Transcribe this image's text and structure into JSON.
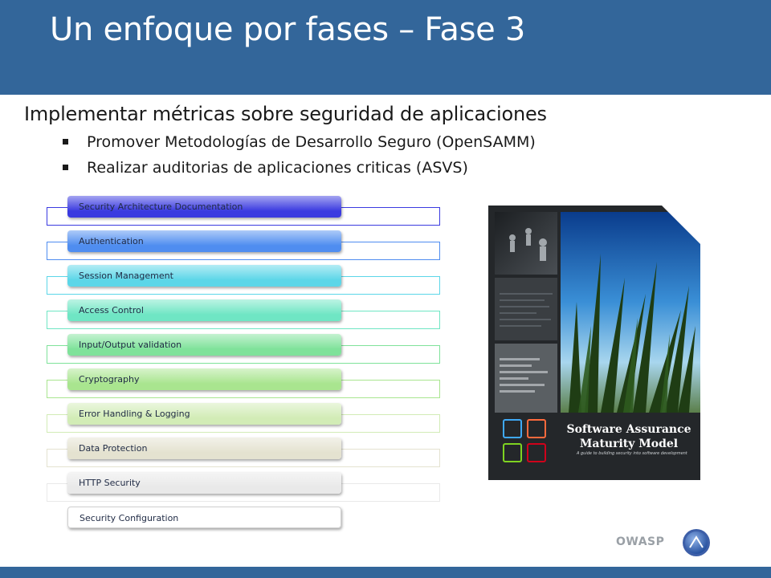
{
  "slide": {
    "title": "Un enfoque por fases – Fase 3",
    "subtitle": "Implementar métricas sobre seguridad de aplicaciones",
    "bullets": [
      "Promover Metodologías de Desarrollo Seguro (OpenSAMM)",
      "Realizar auditorias de aplicaciones criticas (ASVS)"
    ]
  },
  "verification_list": {
    "items": [
      {
        "label": "Security Architecture Documentation",
        "color": "#3a3ae0"
      },
      {
        "label": "Authentication",
        "color": "#4f8df0"
      },
      {
        "label": "Session Management",
        "color": "#5cd6e8"
      },
      {
        "label": "Access Control",
        "color": "#6fe6c4"
      },
      {
        "label": "Input/Output validation",
        "color": "#7fe29a"
      },
      {
        "label": "Cryptography",
        "color": "#a9e58f"
      },
      {
        "label": "Error Handling & Logging",
        "color": "#d2ecb6"
      },
      {
        "label": "Data Protection",
        "color": "#e4e2d0"
      },
      {
        "label": "HTTP Security",
        "color": "#e9e9e9"
      },
      {
        "label": "Security Configuration",
        "color": "#ffffff"
      }
    ]
  },
  "book_cover": {
    "title_line1": "Software Assurance",
    "title_line2": "Maturity Model",
    "caption": "A guide to building security into software development"
  },
  "footer": {
    "brand": "OWASP",
    "accent": "#33669a"
  }
}
